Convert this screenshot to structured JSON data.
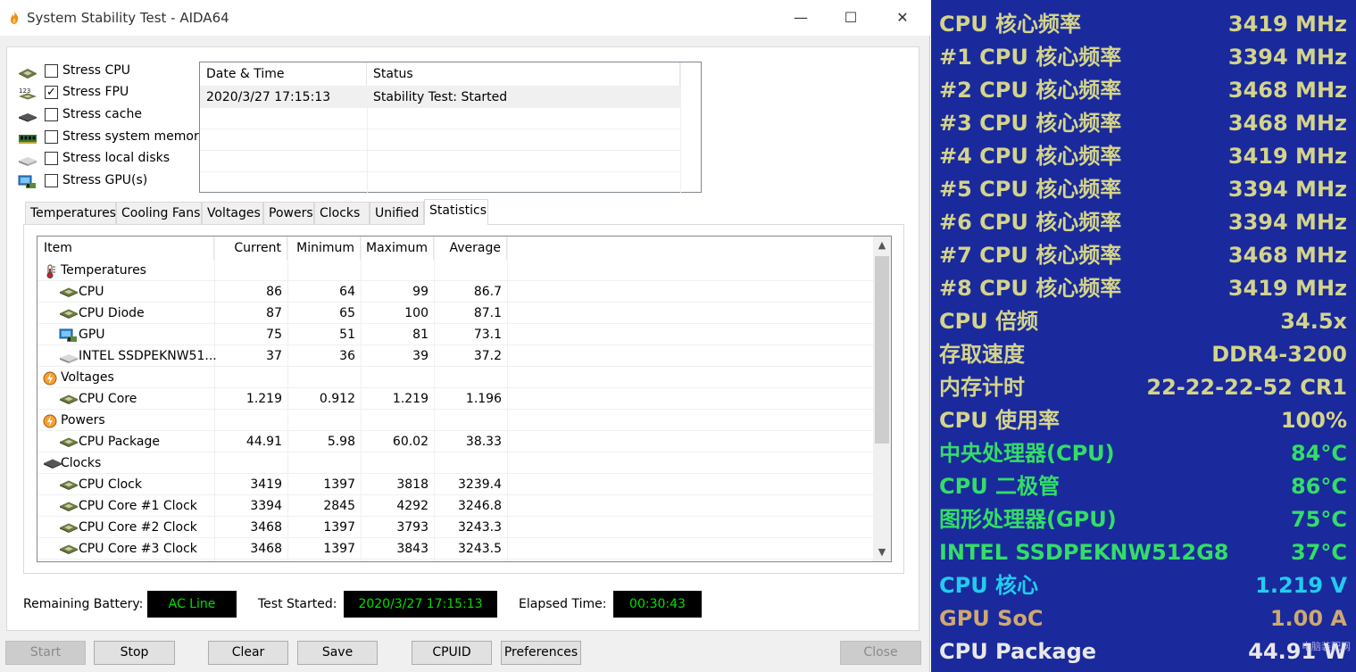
{
  "window": {
    "title": "System Stability Test - AIDA64"
  },
  "stress": [
    {
      "label": "Stress CPU",
      "checked": false,
      "icon": "cpu-chip-icon"
    },
    {
      "label": "Stress FPU",
      "checked": true,
      "icon": "fpu-icon"
    },
    {
      "label": "Stress cache",
      "checked": false,
      "icon": "cache-icon"
    },
    {
      "label": "Stress system memory",
      "checked": false,
      "icon": "memory-icon"
    },
    {
      "label": "Stress local disks",
      "checked": false,
      "icon": "disk-icon"
    },
    {
      "label": "Stress GPU(s)",
      "checked": false,
      "icon": "gpu-icon"
    }
  ],
  "status_table": {
    "headers": [
      "Date & Time",
      "Status"
    ],
    "rows": [
      {
        "datetime": "2020/3/27 17:15:13",
        "status": "Stability Test: Started"
      }
    ]
  },
  "tabs": [
    "Temperatures",
    "Cooling Fans",
    "Voltages",
    "Powers",
    "Clocks",
    "Unified",
    "Statistics"
  ],
  "active_tab": "Statistics",
  "stats": {
    "headers": [
      "Item",
      "Current",
      "Minimum",
      "Maximum",
      "Average"
    ],
    "rows": [
      {
        "group": true,
        "icon": "thermometer-icon",
        "item": "Temperatures"
      },
      {
        "icon": "chip-icon",
        "item": "CPU",
        "current": "86",
        "minimum": "64",
        "maximum": "99",
        "average": "86.7"
      },
      {
        "icon": "chip-icon",
        "item": "CPU Diode",
        "current": "87",
        "minimum": "65",
        "maximum": "100",
        "average": "87.1"
      },
      {
        "icon": "gpu-icon",
        "item": "GPU",
        "current": "75",
        "minimum": "51",
        "maximum": "81",
        "average": "73.1"
      },
      {
        "icon": "disk-icon",
        "item": "INTEL SSDPEKNW51...",
        "current": "37",
        "minimum": "36",
        "maximum": "39",
        "average": "37.2"
      },
      {
        "group": true,
        "icon": "voltage-icon",
        "item": "Voltages"
      },
      {
        "icon": "chip-icon",
        "item": "CPU Core",
        "current": "1.219",
        "minimum": "0.912",
        "maximum": "1.219",
        "average": "1.196"
      },
      {
        "group": true,
        "icon": "power-icon",
        "item": "Powers"
      },
      {
        "icon": "chip-icon",
        "item": "CPU Package",
        "current": "44.91",
        "minimum": "5.98",
        "maximum": "60.02",
        "average": "38.33"
      },
      {
        "group": true,
        "icon": "clock-chip-icon",
        "item": "Clocks"
      },
      {
        "icon": "chip-icon",
        "item": "CPU Clock",
        "current": "3419",
        "minimum": "1397",
        "maximum": "3818",
        "average": "3239.4"
      },
      {
        "icon": "chip-icon",
        "item": "CPU Core #1 Clock",
        "current": "3394",
        "minimum": "2845",
        "maximum": "4292",
        "average": "3246.8"
      },
      {
        "icon": "chip-icon",
        "item": "CPU Core #2 Clock",
        "current": "3468",
        "minimum": "1397",
        "maximum": "3793",
        "average": "3243.3"
      },
      {
        "icon": "chip-icon",
        "item": "CPU Core #3 Clock",
        "current": "3468",
        "minimum": "1397",
        "maximum": "3843",
        "average": "3243.5"
      }
    ]
  },
  "info": {
    "battery_label": "Remaining Battery:",
    "battery_value": "AC Line",
    "started_label": "Test Started:",
    "started_value": "2020/3/27 17:15:13",
    "elapsed_label": "Elapsed Time:",
    "elapsed_value": "00:30:43"
  },
  "buttons": {
    "start": "Start",
    "stop": "Stop",
    "clear": "Clear",
    "save": "Save",
    "cpuid": "CPUID",
    "preferences": "Preferences",
    "close": "Close"
  },
  "osd": {
    "background": "#1a2a9c",
    "rows": [
      {
        "label": "CPU 核心频率",
        "value": "3419 MHz",
        "color": "#d4d48a"
      },
      {
        "label": "#1 CPU 核心频率",
        "value": "3394 MHz",
        "color": "#d4d48a"
      },
      {
        "label": "#2 CPU 核心频率",
        "value": "3468 MHz",
        "color": "#d4d48a"
      },
      {
        "label": "#3 CPU 核心频率",
        "value": "3468 MHz",
        "color": "#d4d48a"
      },
      {
        "label": "#4 CPU 核心频率",
        "value": "3419 MHz",
        "color": "#d4d48a"
      },
      {
        "label": "#5 CPU 核心频率",
        "value": "3394 MHz",
        "color": "#d4d48a"
      },
      {
        "label": "#6 CPU 核心频率",
        "value": "3394 MHz",
        "color": "#d4d48a"
      },
      {
        "label": "#7 CPU 核心频率",
        "value": "3468 MHz",
        "color": "#d4d48a"
      },
      {
        "label": "#8 CPU 核心频率",
        "value": "3419 MHz",
        "color": "#d4d48a"
      },
      {
        "label": "CPU 倍频",
        "value": "34.5x",
        "color": "#d4d48a"
      },
      {
        "label": "存取速度",
        "value": "DDR4-3200",
        "color": "#d4d48a"
      },
      {
        "label": "内存计时",
        "value": "22-22-22-52 CR1",
        "color": "#d4d48a"
      },
      {
        "label": "CPU 使用率",
        "value": "100%",
        "color": "#d4d48a"
      },
      {
        "label": "中央处理器(CPU)",
        "value": "84°C",
        "color": "#33dd66"
      },
      {
        "label": "CPU 二极管",
        "value": "86°C",
        "color": "#33dd66"
      },
      {
        "label": "图形处理器(GPU)",
        "value": "75°C",
        "color": "#33dd66"
      },
      {
        "label": "INTEL SSDPEKNW512G8",
        "value": "37°C",
        "color": "#33dd66"
      },
      {
        "label": "CPU 核心",
        "value": "1.219 V",
        "color": "#22ccee"
      },
      {
        "label": "GPU SoC",
        "value": "1.00 A",
        "color": "#d0a870"
      },
      {
        "label": "CPU Package",
        "value": "44.91 W",
        "color": "#e8e8e8"
      }
    ],
    "watermark": "电脑装配网"
  }
}
